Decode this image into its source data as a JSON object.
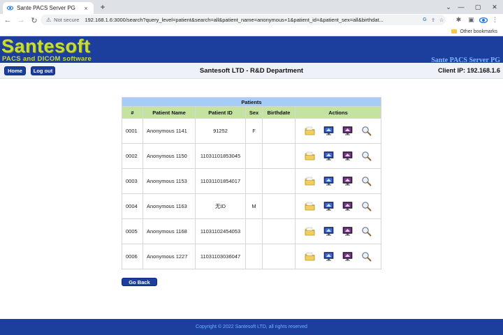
{
  "browser": {
    "tab_title": "Sante PACS Server PG",
    "tab_close": "×",
    "new_tab": "+",
    "address_security": "Not secure",
    "url": "192.168.1.6:3000/search?query_level=patient&search=all&patient_name=anonymous+1&patient_id=&patient_sex=all&birthdat...",
    "other_bookmarks": "Other bookmarks"
  },
  "header": {
    "logo": "Santesoft",
    "logo_subtitle": "PACS and DICOM software",
    "server_name": "Sante PACS Server PG"
  },
  "nav": {
    "home": "Home",
    "logout": "Log out",
    "organization": "Santesoft LTD - R&D Department",
    "client_ip": "Client IP: 192.168.1.6"
  },
  "table": {
    "caption": "Patients",
    "columns": [
      "#",
      "Patient Name",
      "Patient ID",
      "Sex",
      "Birthdate",
      "Actions"
    ],
    "rows": [
      {
        "num": "0001",
        "name": "Anonymous 1141",
        "id": "91252",
        "sex": "F",
        "birthdate": ""
      },
      {
        "num": "0002",
        "name": "Anonymous 1150",
        "id": "11031101853045",
        "sex": "",
        "birthdate": ""
      },
      {
        "num": "0003",
        "name": "Anonymous 1153",
        "id": "11031101854017",
        "sex": "",
        "birthdate": ""
      },
      {
        "num": "0004",
        "name": "Anonymous 1163",
        "id": "无ID",
        "sex": "M",
        "birthdate": ""
      },
      {
        "num": "0005",
        "name": "Anonymous 1168",
        "id": "11031102454053",
        "sex": "",
        "birthdate": ""
      },
      {
        "num": "0006",
        "name": "Anonymous 1227",
        "id": "11031103036047",
        "sex": "",
        "birthdate": ""
      }
    ]
  },
  "go_back": "Go Back",
  "footer": {
    "copyright": "Copyright © 2022 Santesoft LTD, all rights reserved"
  },
  "colors": {
    "brand_blue": "#1c3f9e",
    "logo_green": "#c7dc34",
    "caption_blue": "#a5cdf5",
    "header_green": "#c4e3a0"
  },
  "icons": [
    "folder-icon",
    "monitor-study-icon",
    "monitor-image-icon",
    "magnifier-icon"
  ]
}
